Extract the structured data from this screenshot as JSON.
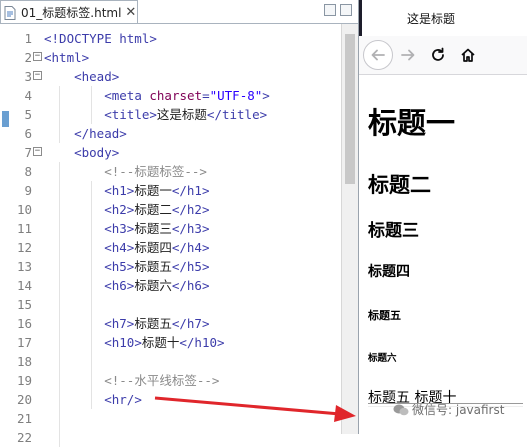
{
  "editor": {
    "tab_label": "01_标题标签.html",
    "close_glyph": "✕",
    "lines": [
      {
        "num": "1",
        "fold": "",
        "segs": [
          {
            "c": "t-tag",
            "t": "<!DOCTYPE html>"
          }
        ]
      },
      {
        "num": "2",
        "fold": "−",
        "segs": [
          {
            "c": "t-tag",
            "t": "<html>"
          }
        ]
      },
      {
        "num": "3",
        "fold": "−",
        "segs": [
          {
            "c": "t-txt",
            "t": "    "
          },
          {
            "c": "t-tag",
            "t": "<head>"
          }
        ]
      },
      {
        "num": "4",
        "fold": "",
        "segs": [
          {
            "c": "t-txt",
            "t": "        "
          },
          {
            "c": "t-tag",
            "t": "<meta "
          },
          {
            "c": "t-attr",
            "t": "charset"
          },
          {
            "c": "t-tag",
            "t": "="
          },
          {
            "c": "t-val",
            "t": "\"UTF-8\""
          },
          {
            "c": "t-tag",
            "t": ">"
          }
        ]
      },
      {
        "num": "5",
        "fold": "",
        "segs": [
          {
            "c": "t-txt",
            "t": "        "
          },
          {
            "c": "t-tag",
            "t": "<title>"
          },
          {
            "c": "t-txt",
            "t": "这是标题"
          },
          {
            "c": "t-tag",
            "t": "</title>"
          }
        ]
      },
      {
        "num": "6",
        "fold": "",
        "segs": [
          {
            "c": "t-txt",
            "t": "    "
          },
          {
            "c": "t-tag",
            "t": "</head>"
          }
        ]
      },
      {
        "num": "7",
        "fold": "−",
        "segs": [
          {
            "c": "t-txt",
            "t": "    "
          },
          {
            "c": "t-tag",
            "t": "<body>"
          }
        ]
      },
      {
        "num": "8",
        "fold": "",
        "segs": [
          {
            "c": "t-txt",
            "t": "        "
          },
          {
            "c": "t-cmt",
            "t": "<!--标题标签-->"
          }
        ]
      },
      {
        "num": "9",
        "fold": "",
        "segs": [
          {
            "c": "t-txt",
            "t": "        "
          },
          {
            "c": "t-tag",
            "t": "<h1>"
          },
          {
            "c": "t-txt",
            "t": "标题一"
          },
          {
            "c": "t-tag",
            "t": "</h1>"
          }
        ]
      },
      {
        "num": "10",
        "fold": "",
        "segs": [
          {
            "c": "t-txt",
            "t": "        "
          },
          {
            "c": "t-tag",
            "t": "<h2>"
          },
          {
            "c": "t-txt",
            "t": "标题二"
          },
          {
            "c": "t-tag",
            "t": "</h2>"
          }
        ]
      },
      {
        "num": "11",
        "fold": "",
        "segs": [
          {
            "c": "t-txt",
            "t": "        "
          },
          {
            "c": "t-tag",
            "t": "<h3>"
          },
          {
            "c": "t-txt",
            "t": "标题三"
          },
          {
            "c": "t-tag",
            "t": "</h3>"
          }
        ]
      },
      {
        "num": "12",
        "fold": "",
        "segs": [
          {
            "c": "t-txt",
            "t": "        "
          },
          {
            "c": "t-tag",
            "t": "<h4>"
          },
          {
            "c": "t-txt",
            "t": "标题四"
          },
          {
            "c": "t-tag",
            "t": "</h4>"
          }
        ]
      },
      {
        "num": "13",
        "fold": "",
        "segs": [
          {
            "c": "t-txt",
            "t": "        "
          },
          {
            "c": "t-tag",
            "t": "<h5>"
          },
          {
            "c": "t-txt",
            "t": "标题五"
          },
          {
            "c": "t-tag",
            "t": "</h5>"
          }
        ]
      },
      {
        "num": "14",
        "fold": "",
        "segs": [
          {
            "c": "t-txt",
            "t": "        "
          },
          {
            "c": "t-tag",
            "t": "<h6>"
          },
          {
            "c": "t-txt",
            "t": "标题六"
          },
          {
            "c": "t-tag",
            "t": "</h6>"
          }
        ]
      },
      {
        "num": "15",
        "fold": "",
        "segs": []
      },
      {
        "num": "16",
        "fold": "",
        "segs": [
          {
            "c": "t-txt",
            "t": "        "
          },
          {
            "c": "t-tag",
            "t": "<h7>"
          },
          {
            "c": "t-txt",
            "t": "标题五"
          },
          {
            "c": "t-tag",
            "t": "</h7>"
          }
        ]
      },
      {
        "num": "17",
        "fold": "",
        "segs": [
          {
            "c": "t-txt",
            "t": "        "
          },
          {
            "c": "t-tag",
            "t": "<h10>"
          },
          {
            "c": "t-txt",
            "t": "标题十"
          },
          {
            "c": "t-tag",
            "t": "</h10>"
          }
        ]
      },
      {
        "num": "18",
        "fold": "",
        "segs": []
      },
      {
        "num": "19",
        "fold": "",
        "segs": [
          {
            "c": "t-txt",
            "t": "        "
          },
          {
            "c": "t-cmt",
            "t": "<!--水平线标签-->"
          }
        ]
      },
      {
        "num": "20",
        "fold": "",
        "segs": [
          {
            "c": "t-txt",
            "t": "        "
          },
          {
            "c": "t-tag",
            "t": "<hr/>"
          }
        ]
      },
      {
        "num": "21",
        "fold": "",
        "segs": []
      },
      {
        "num": "22",
        "fold": "",
        "segs": []
      }
    ]
  },
  "browser": {
    "tab_title": "这是标题",
    "nav_icons": [
      "back-arrow-icon",
      "forward-arrow-icon",
      "reload-icon",
      "home-icon"
    ],
    "headings": {
      "h1": "标题一",
      "h2": "标题二",
      "h3": "标题三",
      "h4": "标题四",
      "h5": "标题五",
      "h6": "标题六"
    },
    "plain_text": "标题五 标题十"
  },
  "watermark": "微信号: javafirst",
  "colors": {
    "arrow": "#e0262b",
    "gutter_marker": "#6a9fd1",
    "tag": "#3c3caa",
    "comment": "#8a8a8a",
    "attribute": "#7f0055",
    "value": "#2a00ff"
  }
}
